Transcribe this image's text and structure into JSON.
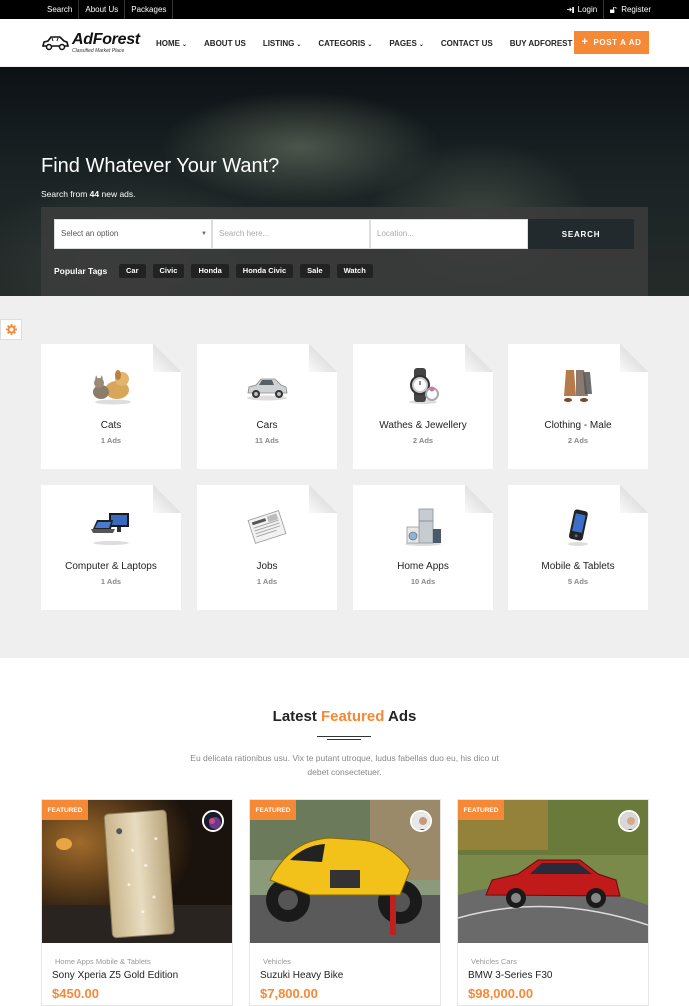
{
  "topbar": {
    "links": [
      "Search",
      "About Us",
      "Packages"
    ],
    "login": "Login",
    "register": "Register"
  },
  "header": {
    "logo_title": "AdForest",
    "logo_subtitle": "Classified Market Place",
    "nav": [
      {
        "label": "HOME",
        "dropdown": true
      },
      {
        "label": "ABOUT US",
        "dropdown": false
      },
      {
        "label": "LISTING",
        "dropdown": true
      },
      {
        "label": "CATEGORIS",
        "dropdown": true
      },
      {
        "label": "PAGES",
        "dropdown": true
      },
      {
        "label": "CONTACT US",
        "dropdown": false
      },
      {
        "label": "BUY ADFOREST",
        "dropdown": false
      }
    ],
    "post_button": "POST A AD",
    "accent_color": "#f58936"
  },
  "hero": {
    "title": "Find Whatever Your Want?",
    "subtitle_prefix": "Search from ",
    "subtitle_count": "44",
    "subtitle_suffix": " new ads.",
    "select_placeholder": "Select an option",
    "search_placeholder": "Search here...",
    "location_placeholder": "Location...",
    "search_button": "SEARCH",
    "popular_tags_label": "Popular Tags",
    "tags": [
      "Car",
      "Civic",
      "Honda",
      "Honda Civic",
      "Sale",
      "Watch"
    ]
  },
  "categories": [
    {
      "name": "Cats",
      "count": "1 Ads",
      "icon": "pets-icon"
    },
    {
      "name": "Cars",
      "count": "11 Ads",
      "icon": "car-icon"
    },
    {
      "name": "Wathes & Jewellery",
      "count": "2 Ads",
      "icon": "watch-icon"
    },
    {
      "name": "Clothing - Male",
      "count": "2 Ads",
      "icon": "clothing-icon"
    },
    {
      "name": "Computer & Laptops",
      "count": "1 Ads",
      "icon": "computer-icon"
    },
    {
      "name": "Jobs",
      "count": "1 Ads",
      "icon": "newspaper-icon"
    },
    {
      "name": "Home Apps",
      "count": "10 Ads",
      "icon": "appliances-icon"
    },
    {
      "name": "Mobile & Tablets",
      "count": "5 Ads",
      "icon": "mobile-icon"
    }
  ],
  "latest": {
    "title_a": "Latest ",
    "title_b": "Featured",
    "title_c": " Ads",
    "description": "Eu delicata rationibus usu. Vix te putant utroque, ludus fabellas duo eu, his dico ut debet consectetuer."
  },
  "ads": [
    {
      "badge": "FEATURED",
      "category": "Home Apps Mobile & Tablets",
      "title": "Sony Xperia Z5 Gold Edition",
      "price": "$450.00"
    },
    {
      "badge": "FEATURED",
      "category": "Vehicles",
      "title": "Suzuki Heavy Bike",
      "price": "$7,800.00"
    },
    {
      "badge": "FEATURED",
      "category": "Vehicles Cars",
      "title": "BMW 3-Series F30",
      "price": "$98,000.00"
    }
  ]
}
